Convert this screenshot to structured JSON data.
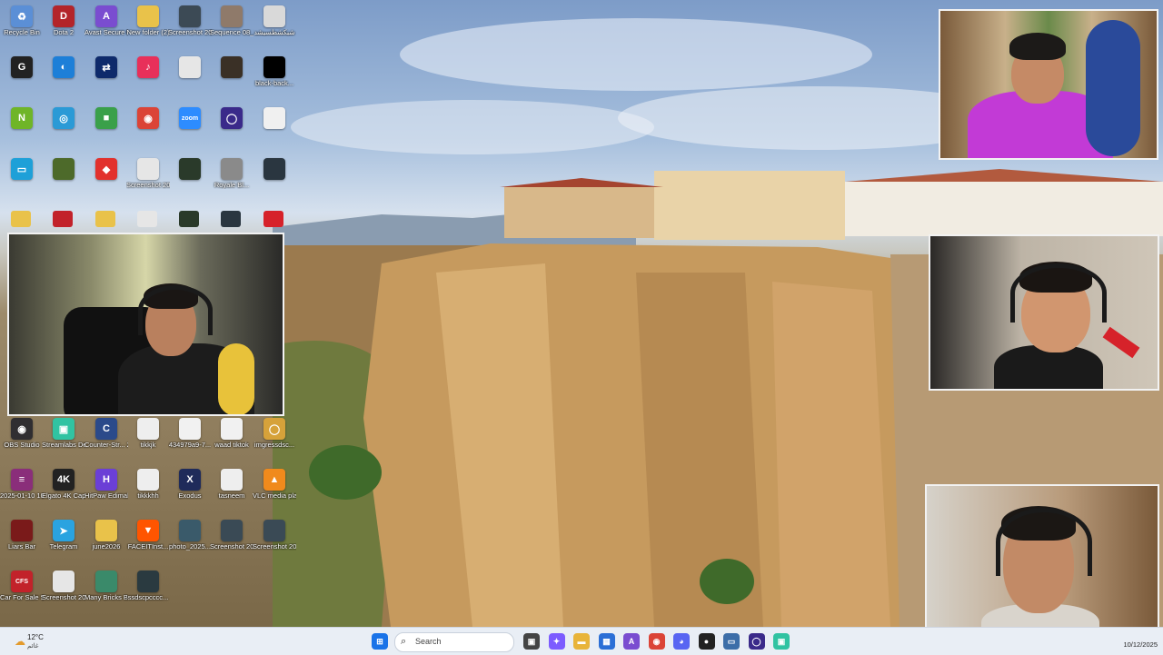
{
  "desktop": {
    "icons": [
      {
        "label": "Recycle Bin",
        "icon": "recycle-bin-icon",
        "color": "#5b8fd6",
        "glyph": "♻"
      },
      {
        "label": "Dota 2",
        "icon": "dota2-icon",
        "color": "#b3242a",
        "glyph": "D"
      },
      {
        "label": "Avast Secure Browser",
        "icon": "avast-browser-icon",
        "color": "#7a4dd0",
        "glyph": "A"
      },
      {
        "label": "New folder (2)",
        "icon": "folder-icon",
        "color": "#e9c24a",
        "glyph": ""
      },
      {
        "label": "Screenshot 2025-09oo...",
        "icon": "image-file-icon",
        "color": "#3c4a55",
        "glyph": ""
      },
      {
        "label": "Sequence 08_1",
        "icon": "video-file-icon",
        "color": "#8f7a6a",
        "glyph": ""
      },
      {
        "label": "شبكشطسيشد",
        "icon": "image-file-icon",
        "color": "#d9d9d9",
        "glyph": ""
      },
      {
        "label": "",
        "icon": "app-g-icon",
        "color": "#222222",
        "glyph": "G"
      },
      {
        "label": "",
        "icon": "app-blue-icon",
        "color": "#1d7fd8",
        "glyph": "◐"
      },
      {
        "label": "",
        "icon": "teamviewer-icon",
        "color": "#0e2a6b",
        "glyph": "⇄"
      },
      {
        "label": "",
        "icon": "tiktok-icon",
        "color": "#e8305a",
        "glyph": "♪"
      },
      {
        "label": "",
        "icon": "text-file-icon",
        "color": "#e6e6e6",
        "glyph": ""
      },
      {
        "label": "",
        "icon": "game-icon",
        "color": "#3a3026",
        "glyph": ""
      },
      {
        "label": "black-back...",
        "icon": "image-file-icon",
        "color": "#000000",
        "glyph": ""
      },
      {
        "label": "",
        "icon": "nvidia-icon",
        "color": "#6fb528",
        "glyph": "N"
      },
      {
        "label": "",
        "icon": "app-globe-icon",
        "color": "#2b9ad6",
        "glyph": "◎"
      },
      {
        "label": "",
        "icon": "app-store-icon",
        "color": "#3aa04a",
        "glyph": "■"
      },
      {
        "label": "",
        "icon": "chrome-icon",
        "color": "#db4437",
        "glyph": "◉"
      },
      {
        "label": "",
        "icon": "zoom-icon",
        "color": "#2d8cff",
        "glyph": "zoom"
      },
      {
        "label": "",
        "icon": "app-ring-icon",
        "color": "#3a2a8a",
        "glyph": "◯"
      },
      {
        "label": "",
        "icon": "image-file-icon",
        "color": "#f0f0f0",
        "glyph": ""
      },
      {
        "label": "",
        "icon": "monitor-icon",
        "color": "#1ea0d8",
        "glyph": "▭"
      },
      {
        "label": "",
        "icon": "game-icon",
        "color": "#4d6a2a",
        "glyph": ""
      },
      {
        "label": "",
        "icon": "anydesk-icon",
        "color": "#e2312d",
        "glyph": "◆"
      },
      {
        "label": "Screenshot 2025-09-2...",
        "icon": "image-file-icon",
        "color": "#e6e6e6",
        "glyph": ""
      },
      {
        "label": "",
        "icon": "phone-image-icon",
        "color": "#2a3a2a",
        "glyph": ""
      },
      {
        "label": "Royale Bl...",
        "icon": "image-file-icon",
        "color": "#8a8a8a",
        "glyph": ""
      },
      {
        "label": "",
        "icon": "image-file-icon",
        "color": "#2a3640",
        "glyph": ""
      },
      {
        "label": "OBS Studio",
        "icon": "obs-icon",
        "color": "#302e31",
        "glyph": "◉"
      },
      {
        "label": "Streamlabs Desktop",
        "icon": "streamlabs-icon",
        "color": "#31c3a2",
        "glyph": "▣"
      },
      {
        "label": "Counter-Str... 2",
        "icon": "cs2-icon",
        "color": "#2b4a8a",
        "glyph": "C"
      },
      {
        "label": "tikkjk",
        "icon": "text-file-icon",
        "color": "#eeeeee",
        "glyph": ""
      },
      {
        "label": "434979a9-7...",
        "icon": "phone-image-icon",
        "color": "#f1f1f1",
        "glyph": ""
      },
      {
        "label": "waad tiktok",
        "icon": "text-file-icon",
        "color": "#f1f1f1",
        "glyph": ""
      },
      {
        "label": "imgressdsc...",
        "icon": "app-ring-icon",
        "color": "#d6a23a",
        "glyph": "◯"
      },
      {
        "label": "2025-01-10 10-37-52",
        "icon": "winrar-icon",
        "color": "#8a2e7a",
        "glyph": "≡"
      },
      {
        "label": "Elgato 4K Capture...",
        "icon": "elgato-icon",
        "color": "#222222",
        "glyph": "4K"
      },
      {
        "label": "HitPaw Edimakor",
        "icon": "hitpaw-icon",
        "color": "#6b3fd6",
        "glyph": "H"
      },
      {
        "label": "tikkkhh",
        "icon": "text-file-icon",
        "color": "#eeeeee",
        "glyph": ""
      },
      {
        "label": "Exodus",
        "icon": "exodus-icon",
        "color": "#1f2b5a",
        "glyph": "X"
      },
      {
        "label": "tasneem",
        "icon": "text-file-icon",
        "color": "#eeeeee",
        "glyph": ""
      },
      {
        "label": "VLC media player",
        "icon": "vlc-icon",
        "color": "#f08a1c",
        "glyph": "▲"
      },
      {
        "label": "Liars Bar",
        "icon": "game-icon",
        "color": "#7a1a1a",
        "glyph": ""
      },
      {
        "label": "Telegram",
        "icon": "telegram-icon",
        "color": "#2aa3e0",
        "glyph": "➤"
      },
      {
        "label": "june2026",
        "icon": "folder-icon",
        "color": "#e9c24a",
        "glyph": ""
      },
      {
        "label": "FACEITInst...",
        "icon": "faceit-icon",
        "color": "#ff5500",
        "glyph": "▼"
      },
      {
        "label": "photo_2025...",
        "icon": "image-file-icon",
        "color": "#3a5a6a",
        "glyph": ""
      },
      {
        "label": "Screenshot 2025-09-08...",
        "icon": "image-file-icon",
        "color": "#3a4a55",
        "glyph": ""
      },
      {
        "label": "Screenshot 2025-09...",
        "icon": "image-file-icon",
        "color": "#3a4a55",
        "glyph": ""
      },
      {
        "label": "Car For Sale Simulator ...",
        "icon": "cfs-icon",
        "color": "#c2222a",
        "glyph": "CFS"
      },
      {
        "label": "Screenshot 2025-06-28...",
        "icon": "image-file-icon",
        "color": "#e6e6e6",
        "glyph": ""
      },
      {
        "label": "Many Bricks Breaker",
        "icon": "game-icon",
        "color": "#3a8a6a",
        "glyph": ""
      },
      {
        "label": "ssdscpcccc...",
        "icon": "image-file-icon",
        "color": "#2a3a40",
        "glyph": ""
      }
    ]
  },
  "taskbar": {
    "weather_temp": "12°C",
    "weather_cond": "غائم",
    "search_placeholder": "Search",
    "clock_date": "10/12/2025",
    "apps": [
      {
        "name": "start-button",
        "color": "#1a73e8",
        "glyph": "⊞"
      },
      {
        "name": "task-view-icon",
        "color": "#444444",
        "glyph": "▣"
      },
      {
        "name": "copilot-icon",
        "color": "#7c5cff",
        "glyph": "✦"
      },
      {
        "name": "file-explorer-icon",
        "color": "#e8b43a",
        "glyph": "▬"
      },
      {
        "name": "microsoft-store-icon",
        "color": "#2b6fd6",
        "glyph": "▦"
      },
      {
        "name": "avast-browser-icon",
        "color": "#7a4dd0",
        "glyph": "A"
      },
      {
        "name": "chrome-icon",
        "color": "#db4437",
        "glyph": "◉"
      },
      {
        "name": "discord-icon",
        "color": "#5865f2",
        "glyph": "◕"
      },
      {
        "name": "app-black-icon",
        "color": "#222222",
        "glyph": "●"
      },
      {
        "name": "app-window-icon",
        "color": "#3c6ea8",
        "glyph": "▭"
      },
      {
        "name": "app-ring-icon",
        "color": "#3a2a8a",
        "glyph": "◯"
      },
      {
        "name": "streamlabs-icon",
        "color": "#31c3a2",
        "glyph": "▣"
      }
    ]
  }
}
